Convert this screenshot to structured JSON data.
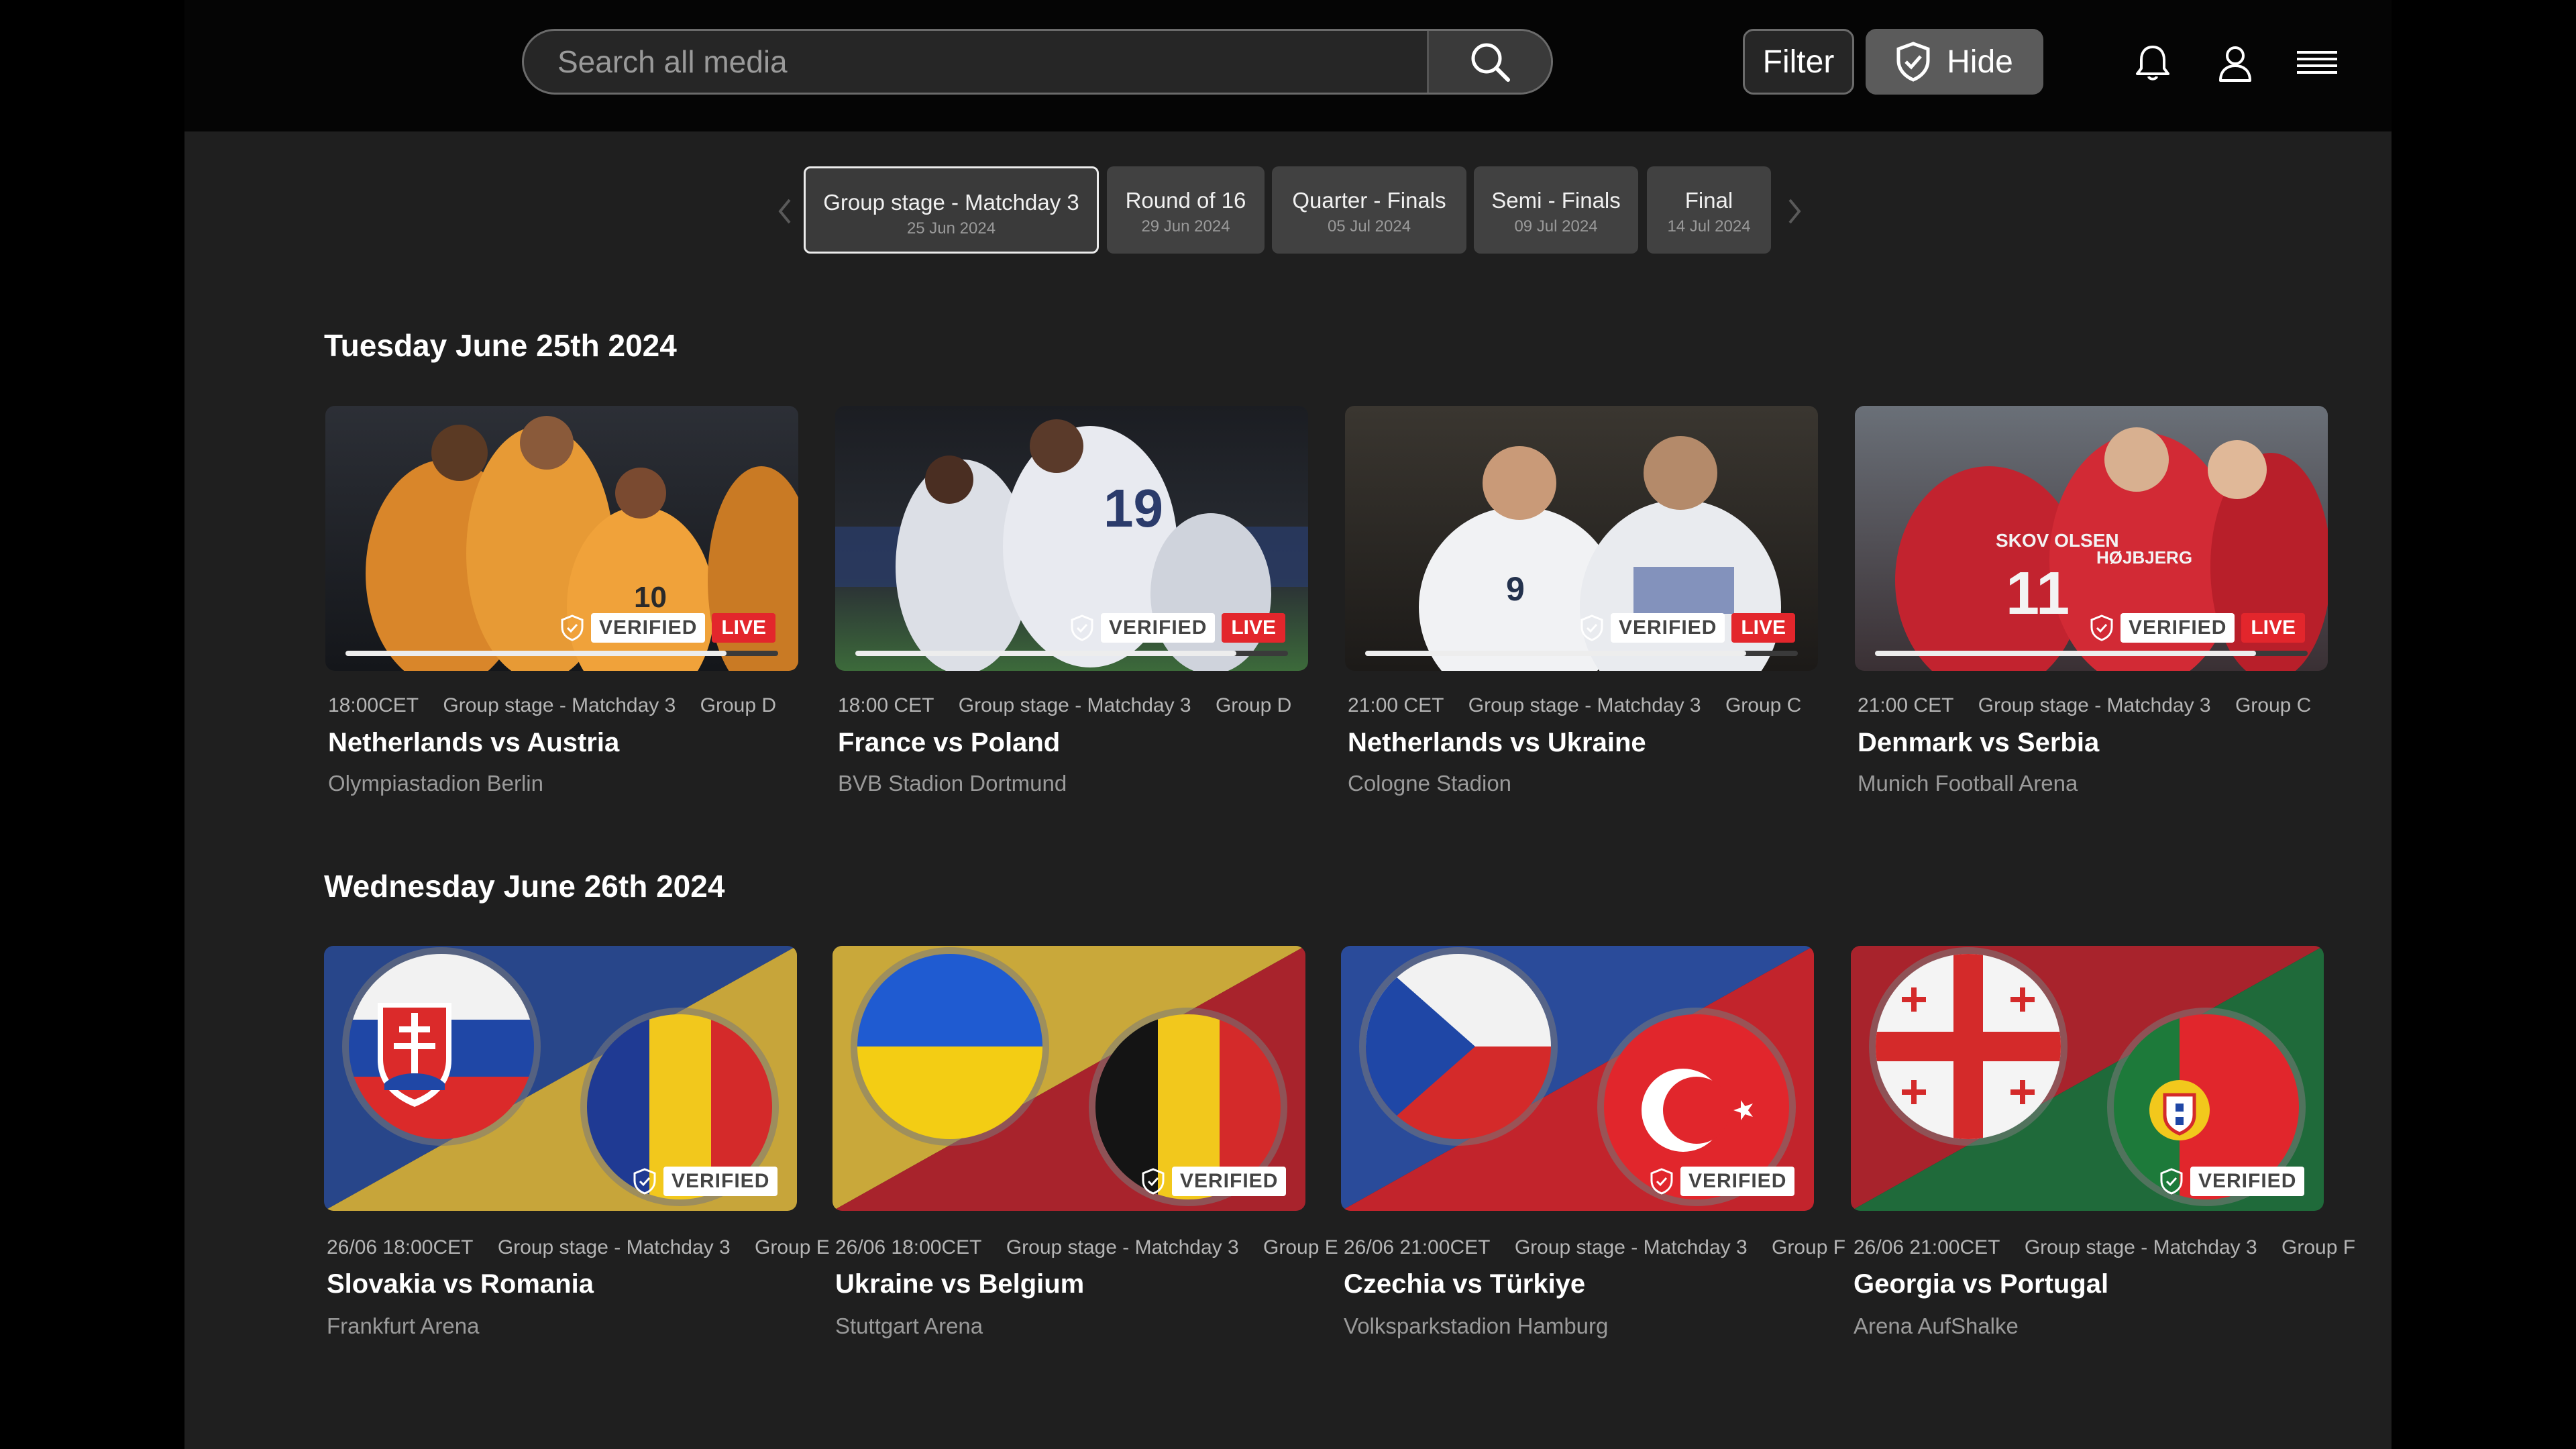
{
  "header": {
    "search_placeholder": "Search all media",
    "filter_label": "Filter",
    "hide_label": "Hide"
  },
  "rounds": [
    {
      "label": "Group stage - Matchday 3",
      "date": "25 Jun 2024",
      "active": true
    },
    {
      "label": "Round of 16",
      "date": "29 Jun 2024",
      "active": false
    },
    {
      "label": "Quarter - Finals",
      "date": "05 Jul 2024",
      "active": false
    },
    {
      "label": "Semi - Finals",
      "date": "09 Jul 2024",
      "active": false
    },
    {
      "label": "Final",
      "date": "14 Jul 2024",
      "active": false
    }
  ],
  "badges": {
    "verified": "VERIFIED",
    "live": "LIVE"
  },
  "sections": [
    {
      "title": "Tuesday June 25th 2024",
      "matches": [
        {
          "time": "18:00CET",
          "stage": "Group stage - Matchday 3",
          "group": "Group D",
          "title": "Netherlands vs Austria",
          "venue": "Olympiastadion Berlin",
          "verified": true,
          "live": true,
          "progress": 0.88
        },
        {
          "time": "18:00 CET",
          "stage": "Group stage - Matchday 3",
          "group": "Group D",
          "title": "France vs Poland",
          "venue": "BVB Stadion Dortmund",
          "verified": true,
          "live": true,
          "progress": 0.88
        },
        {
          "time": "21:00 CET",
          "stage": "Group stage - Matchday 3",
          "group": "Group C",
          "title": "Netherlands vs Ukraine",
          "venue": "Cologne Stadion",
          "verified": true,
          "live": true,
          "progress": 0.88
        },
        {
          "time": "21:00 CET",
          "stage": "Group stage - Matchday 3",
          "group": "Group C",
          "title": "Denmark vs Serbia",
          "venue": "Munich Football Arena",
          "verified": true,
          "live": true,
          "progress": 0.88
        }
      ]
    },
    {
      "title": "Wednesday June 26th 2024",
      "matches": [
        {
          "time": "26/06 18:00CET",
          "stage": "Group stage - Matchday 3",
          "group": "Group E",
          "title": "Slovakia vs Romania",
          "venue": "Frankfurt Arena",
          "verified": true,
          "live": false
        },
        {
          "time": "26/06 18:00CET",
          "stage": "Group stage - Matchday 3",
          "group": "Group E",
          "title": "Ukraine vs Belgium",
          "venue": "Stuttgart Arena",
          "verified": true,
          "live": false
        },
        {
          "time": "26/06 21:00CET",
          "stage": "Group stage - Matchday 3",
          "group": "Group F",
          "title": "Czechia vs Türkiye",
          "venue": "Volksparkstadion Hamburg",
          "verified": true,
          "live": false
        },
        {
          "time": "26/06 21:00CET",
          "stage": "Group stage - Matchday 3",
          "group": "Group F",
          "title": "Georgia vs Portugal",
          "venue": "Arena AufShalke",
          "verified": true,
          "live": false
        }
      ]
    }
  ],
  "colors": {
    "live": "#e3262c",
    "background": "#1f1f1f",
    "topbar": "#050505"
  },
  "icons": [
    "search-icon",
    "shield-icon",
    "bell-icon",
    "user-icon",
    "menu-icon",
    "chevron-left-icon",
    "chevron-right-icon"
  ]
}
